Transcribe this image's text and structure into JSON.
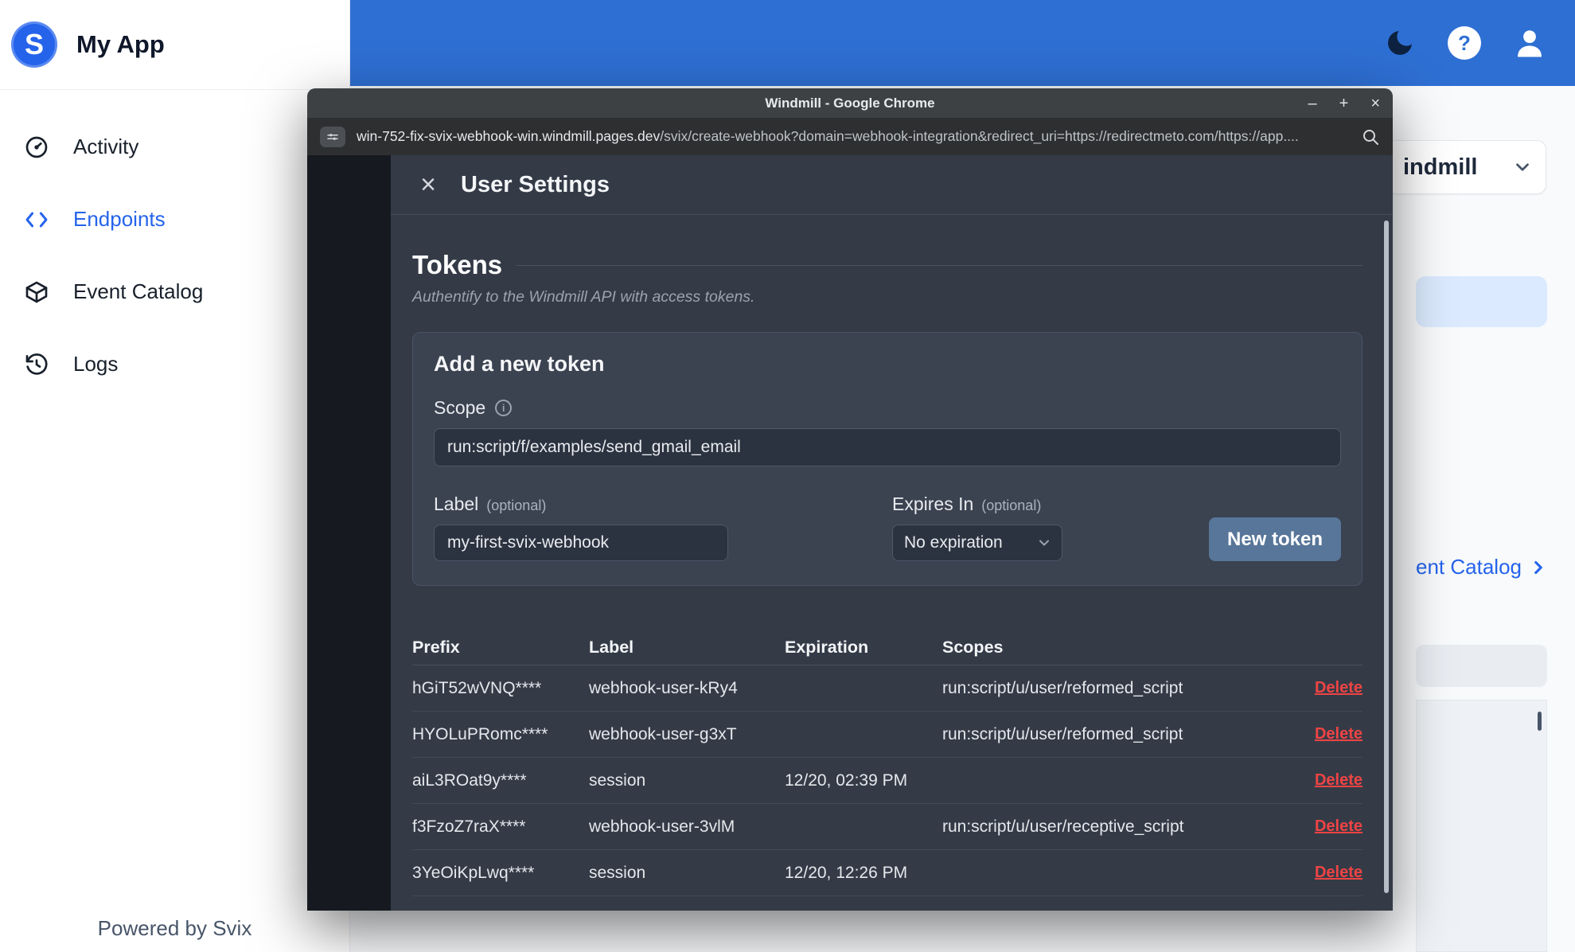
{
  "app": {
    "brand": "My App",
    "sidebar": {
      "items": [
        {
          "label": "Activity"
        },
        {
          "label": "Endpoints"
        },
        {
          "label": "Event Catalog"
        },
        {
          "label": "Logs"
        }
      ],
      "footer": "Powered by Svix"
    },
    "topbar": {
      "help_glyph": "?"
    }
  },
  "background": {
    "org_select_label": "indmill",
    "catalog_link_label": "ent Catalog"
  },
  "chrome": {
    "window_title": "Windmill - Google Chrome",
    "controls": {
      "minimize": "–",
      "maximize": "+",
      "close": "×"
    },
    "url": {
      "domain": "win-752-fix-svix-webhook-win.windmill.pages.dev",
      "path": "/svix/create-webhook?domain=webhook-integration&redirect_uri=https://redirectmeto.com/https://app...."
    }
  },
  "modal": {
    "close_glyph": "×",
    "title": "User Settings",
    "tokens": {
      "heading": "Tokens",
      "subtitle": "Authentify to the Windmill API with access tokens.",
      "card": {
        "title": "Add a new token",
        "scope_label": "Scope",
        "scope_info_glyph": "i",
        "scope_value": "run:script/f/examples/send_gmail_email",
        "label_label": "Label",
        "optional_hint": "(optional)",
        "label_value": "my-first-svix-webhook",
        "expires_label": "Expires In",
        "expires_value": "No expiration",
        "submit_label": "New token"
      },
      "table": {
        "headers": {
          "prefix": "Prefix",
          "label": "Label",
          "expiration": "Expiration",
          "scopes": "Scopes"
        },
        "delete_label": "Delete",
        "rows": [
          {
            "prefix": "hGiT52wVNQ****",
            "label": "webhook-user-kRy4",
            "expiration": "",
            "scopes": "run:script/u/user/reformed_script"
          },
          {
            "prefix": "HYOLuPRomc****",
            "label": "webhook-user-g3xT",
            "expiration": "",
            "scopes": "run:script/u/user/reformed_script"
          },
          {
            "prefix": "aiL3ROat9y****",
            "label": "session",
            "expiration": "12/20, 02:39 PM",
            "scopes": ""
          },
          {
            "prefix": "f3FzoZ7raX****",
            "label": "webhook-user-3vlM",
            "expiration": "",
            "scopes": "run:script/u/user/receptive_script"
          },
          {
            "prefix": "3YeOiKpLwq****",
            "label": "session",
            "expiration": "12/20, 12:26 PM",
            "scopes": ""
          }
        ]
      }
    }
  },
  "colors": {
    "topbar_blue": "#2e6fd3",
    "accent_blue": "#2563eb",
    "danger_red": "#ef4444",
    "submit_button": "#587699"
  }
}
